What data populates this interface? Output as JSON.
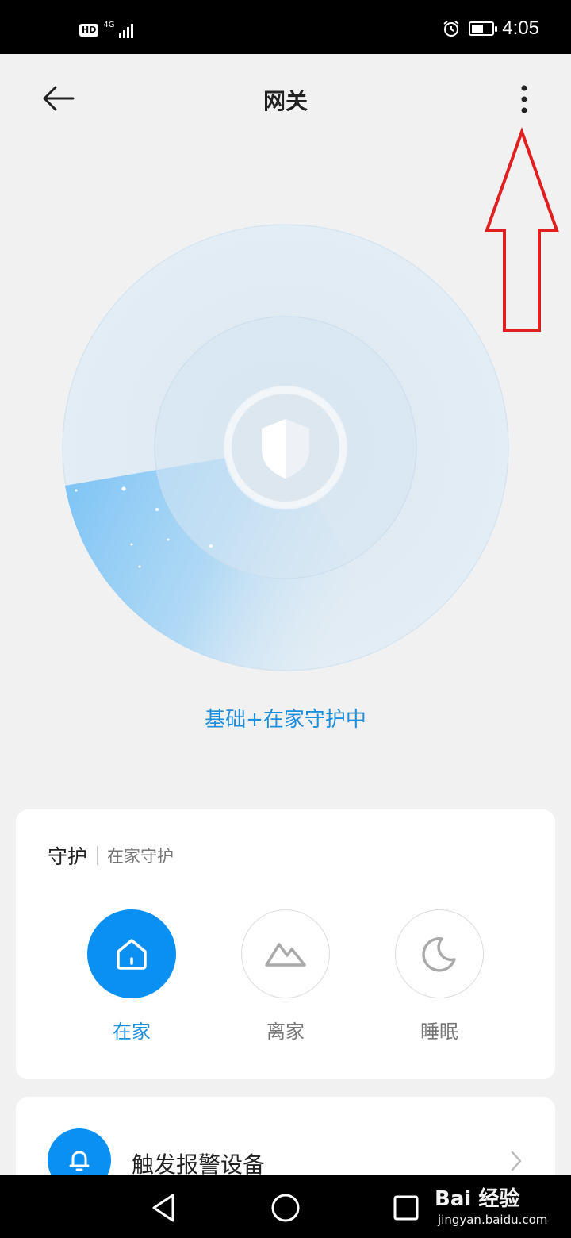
{
  "status_bar": {
    "time": "4:05",
    "hd": "HD",
    "network": "4G",
    "battery_level": 0.6
  },
  "header": {
    "title": "网关"
  },
  "radar": {
    "status_text": "基础+在家守护中"
  },
  "guard_card": {
    "title": "守护",
    "subtitle": "在家守护",
    "modes": [
      {
        "label": "在家",
        "icon": "house-icon",
        "active": true
      },
      {
        "label": "离家",
        "icon": "mountain-icon",
        "active": false
      },
      {
        "label": "睡眠",
        "icon": "moon-icon",
        "active": false
      }
    ]
  },
  "alarm_card": {
    "label": "触发报警设备"
  },
  "watermark": {
    "brand": "Bai 经验",
    "url": "jingyan.baidu.com"
  },
  "colors": {
    "accent": "#0a8ff2",
    "status_text": "#1e8fdc",
    "annotation": "#e02020"
  }
}
